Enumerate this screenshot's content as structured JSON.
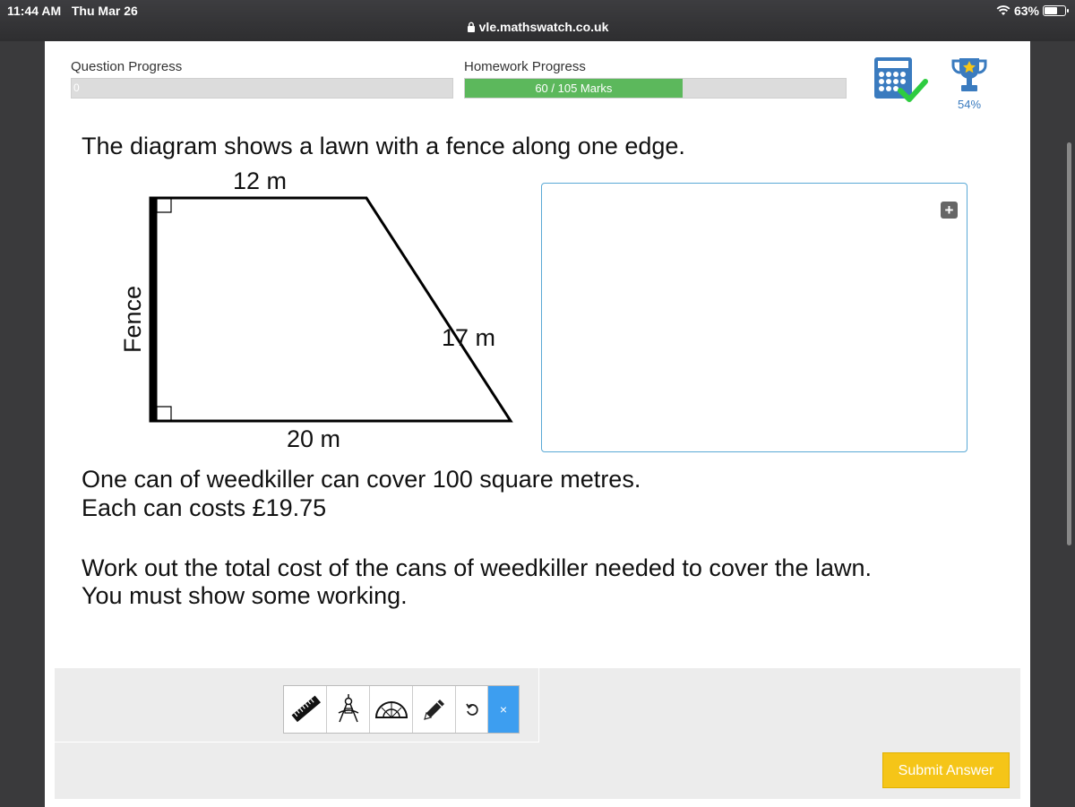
{
  "status_bar": {
    "time": "11:44 AM",
    "date": "Thu Mar 26",
    "battery": "63%",
    "url": "vle.mathswatch.co.uk"
  },
  "progress": {
    "question_label": "Question Progress",
    "question_value": "0",
    "question_fraction": 0,
    "homework_label": "Homework Progress",
    "homework_value": "60 / 105 Marks",
    "homework_fraction": 0.571,
    "score_percent": "54%"
  },
  "question": {
    "intro": "The diagram shows a lawn with a fence along one edge.",
    "line1": "One can of weedkiller can cover 100 square metres.",
    "line2": "Each can costs £19.75",
    "line3": "Work out the total cost of the cans of weedkiller needed to cover the lawn.",
    "line4": "You must show some working."
  },
  "diagram": {
    "top_label": "12 m",
    "slant_label": "17 m",
    "bottom_label": "20 m",
    "fence_label": "Fence"
  },
  "answer": {
    "add_symbol": "+"
  },
  "tools": {
    "items": [
      "ruler-icon",
      "compass-icon",
      "protractor-icon",
      "pencil-icon",
      "undo-icon"
    ],
    "close_label": "×"
  },
  "submit_label": "Submit Answer",
  "colors": {
    "progress_green": "#5cb85c",
    "accent_blue": "#3a7bbf",
    "submit_yellow": "#f5c518",
    "close_blue": "#3d9ef0"
  }
}
